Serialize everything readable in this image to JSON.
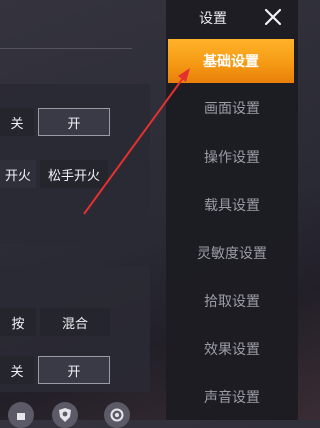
{
  "nav": {
    "title": "设置",
    "items": [
      {
        "label": "基础设置",
        "active": true
      },
      {
        "label": "画面设置",
        "active": false
      },
      {
        "label": "操作设置",
        "active": false
      },
      {
        "label": "载具设置",
        "active": false
      },
      {
        "label": "灵敏度设置",
        "active": false
      },
      {
        "label": "拾取设置",
        "active": false
      },
      {
        "label": "效果设置",
        "active": false
      },
      {
        "label": "声音设置",
        "active": false
      }
    ]
  },
  "panel_a": {
    "off_label": "关",
    "on_label": "开",
    "fire_a": "开火",
    "fire_b": "松手开火"
  },
  "panel_b": {
    "press_label": "按",
    "mix_label": "混合",
    "off_label": "关",
    "on_label": "开"
  },
  "colors": {
    "accent": "#f59a14",
    "arrow": "#e53030"
  },
  "icons": [
    "close-icon",
    "shield-icon",
    "settings-icon"
  ]
}
